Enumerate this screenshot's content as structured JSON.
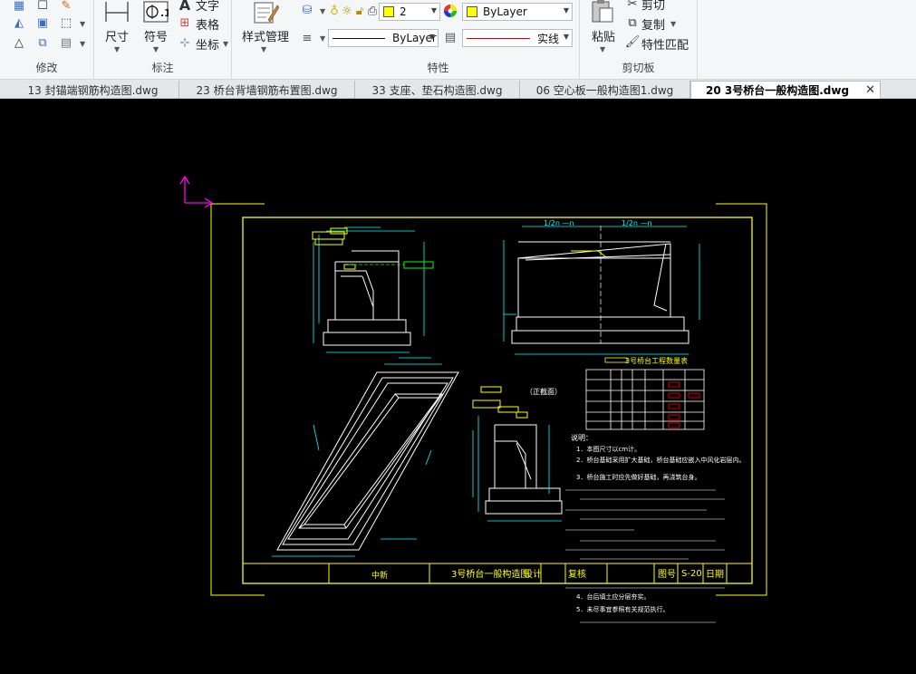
{
  "ribbon": {
    "modify": {
      "label": "修改"
    },
    "annotation": {
      "label": "标注",
      "dimension_label": "尺寸",
      "symbol_label": "符号",
      "text_label": "文字",
      "table_label": "表格",
      "coord_label": "坐标"
    },
    "style": {
      "label": "样式管理"
    },
    "properties": {
      "label": "特性",
      "layer_value": "2",
      "color_value": "ByLayer",
      "linetype_value": "ByLayer",
      "lineweight_value": "实线"
    },
    "clipboard": {
      "label": "剪切板",
      "paste_label": "粘贴",
      "cut_label": "剪切",
      "copy_label": "复制",
      "match_label": "特性匹配"
    }
  },
  "tabs": [
    {
      "label": "13 封锚端钢筋构造图.dwg"
    },
    {
      "label": "23 桥台背墙钢筋布置图.dwg"
    },
    {
      "label": "33 支座、垫石构造图.dwg"
    },
    {
      "label": "06 空心板一般构造图1.dwg"
    },
    {
      "label": "20 3号桥台一般构造图.dwg",
      "active": true
    }
  ],
  "drawing": {
    "title_block": {
      "title": "3号桥台一般构造图",
      "design_label": "设计",
      "review_label": "复核",
      "sheet_label": "图号",
      "sheet_no": "S-20",
      "date_label": "日期",
      "company": "中新"
    },
    "table_title": "3号桥台工程数量表",
    "section_label": "（正截面）",
    "notes_title": "说明：",
    "notes": [
      "1．本图尺寸以cm计。",
      "2．桥台基础采用扩大基础，桥台基础应嵌入中风化岩层内。",
      "3．桥台施工时应先做好基础，再浇筑台身。",
      "4．台后填土应分层夯实。",
      "5．未尽事宜参照有关规范执行。"
    ],
    "colors": {
      "line": "#ffffff",
      "frame": "#ffff00",
      "dim": "#00ffff",
      "axis": "#ff00ff",
      "hatch": "#ff0000",
      "green": "#00ff00"
    }
  }
}
